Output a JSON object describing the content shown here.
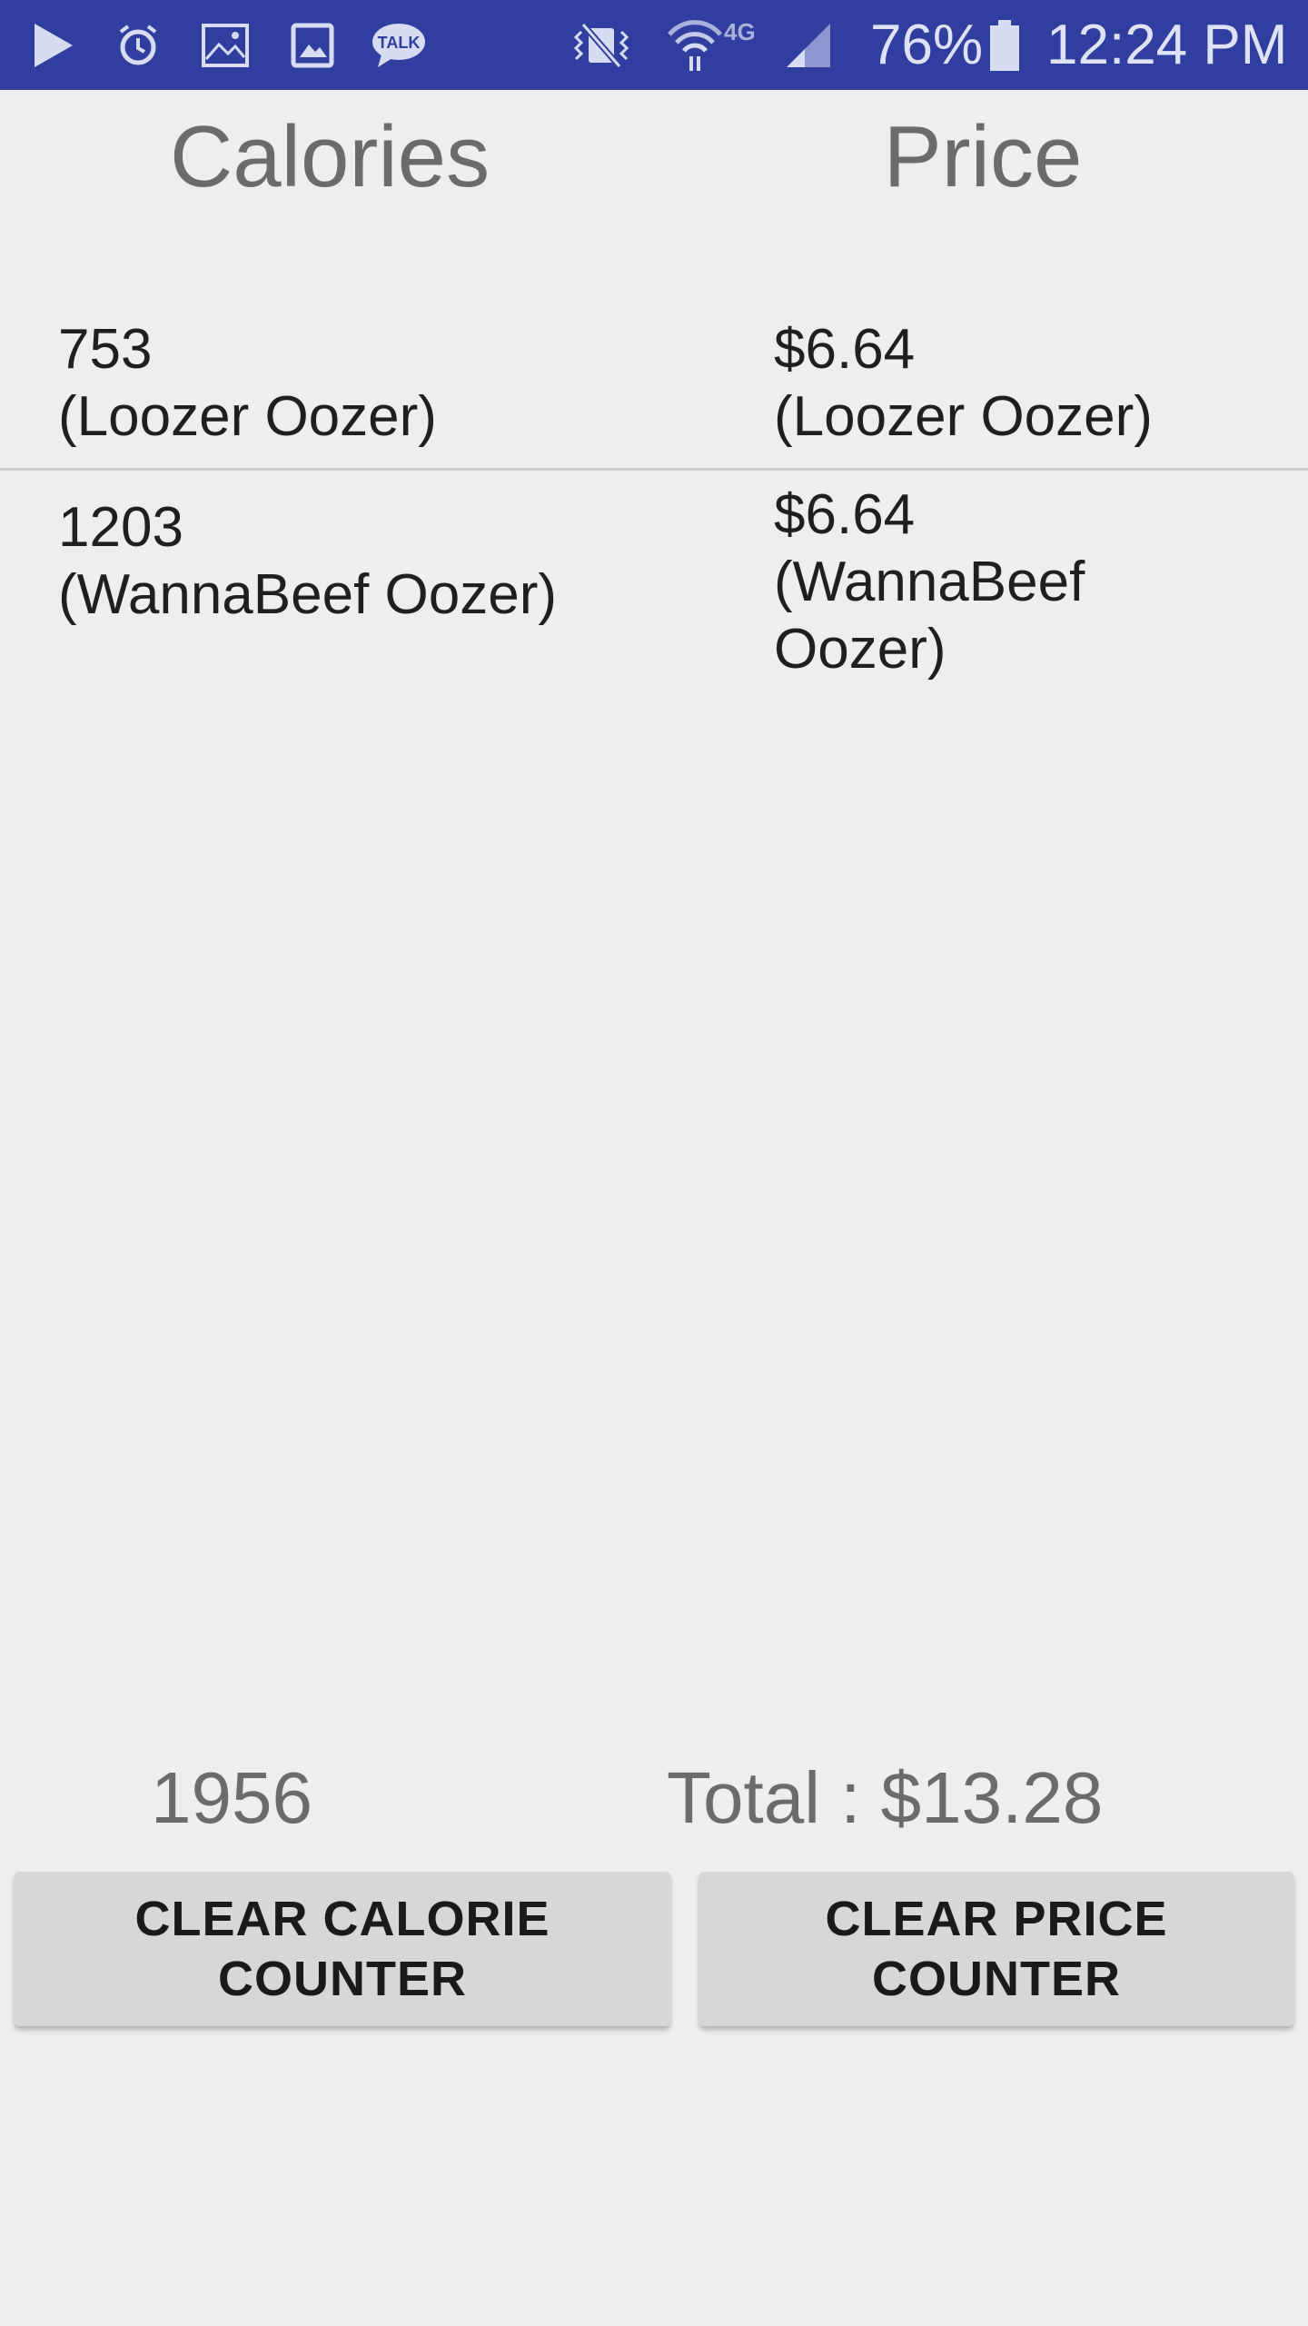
{
  "status_bar": {
    "icons": [
      "play-store-icon",
      "alarm-icon",
      "gallery-icon",
      "image-icon",
      "kakaotalk-icon",
      "vibrate-mute-icon",
      "wifi-icon",
      "signal-icon",
      "battery-icon"
    ],
    "talk_label": "TALK",
    "network_label": "4G",
    "battery_percent": "76%",
    "time": "12:24 PM",
    "bg_color": "#303f9f"
  },
  "headers": {
    "calories": "Calories",
    "price": "Price"
  },
  "items": [
    {
      "calories": "753",
      "calories_name": "(Loozer Oozer)",
      "price": "$6.64",
      "price_name_lines": [
        "(Loozer Oozer)"
      ]
    },
    {
      "calories": "1203",
      "calories_name": "(WannaBeef Oozer)",
      "price": "$6.64",
      "price_name_lines": [
        "(WannaBeef",
        "Oozer)"
      ]
    }
  ],
  "totals": {
    "calories": "1956",
    "price": "Total : $13.28"
  },
  "buttons": {
    "clear_calorie": [
      "CLEAR CALORIE",
      "COUNTER"
    ],
    "clear_price": [
      "CLEAR PRICE",
      "COUNTER"
    ]
  }
}
